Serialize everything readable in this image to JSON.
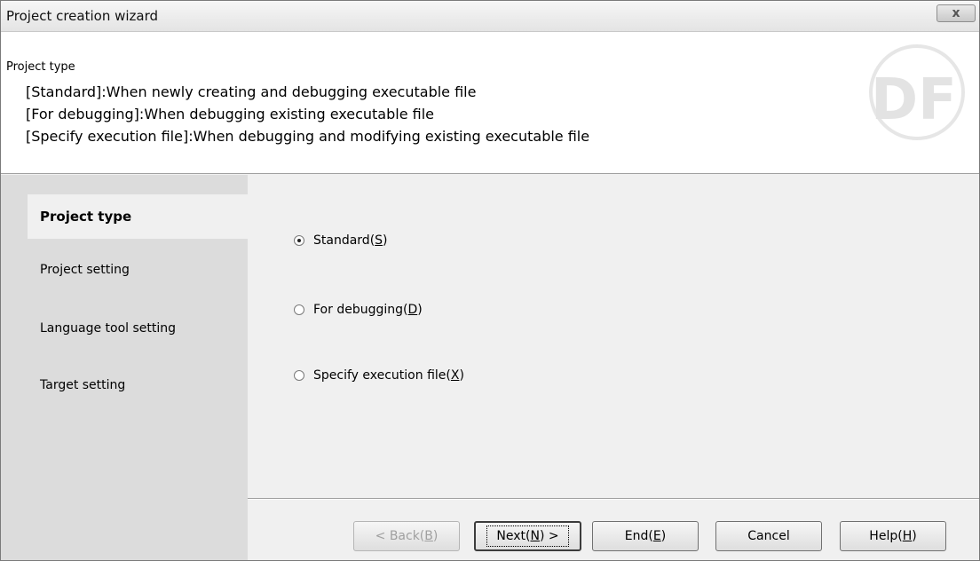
{
  "window": {
    "title": "Project creation wizard",
    "close_label": "x"
  },
  "header": {
    "title": "Project type",
    "lines": [
      "[Standard]:When newly creating and debugging executable file",
      "[For debugging]:When debugging existing executable file",
      "[Specify execution file]:When debugging and modifying existing executable file"
    ],
    "logo_text": "DF"
  },
  "sidebar": {
    "items": [
      {
        "label": "Project type",
        "active": true
      },
      {
        "label": "Project setting",
        "active": false
      },
      {
        "label": "Language tool setting",
        "active": false
      },
      {
        "label": "Target setting",
        "active": false
      }
    ]
  },
  "options": [
    {
      "label": "Standard(",
      "mnemonic": "S",
      "suffix": ")",
      "checked": true
    },
    {
      "label": "For debugging(",
      "mnemonic": "D",
      "suffix": ")",
      "checked": false
    },
    {
      "label": "Specify execution file(",
      "mnemonic": "X",
      "suffix": ")",
      "checked": false
    }
  ],
  "buttons": {
    "back": {
      "pre": "< Back(",
      "key": "B",
      "post": ")"
    },
    "next": {
      "pre": "Next(",
      "key": "N",
      "post": ") >"
    },
    "end": {
      "pre": "End(",
      "key": "E",
      "post": ")"
    },
    "cancel": {
      "label": "Cancel"
    },
    "help": {
      "pre": "Help(",
      "key": "H",
      "post": ")"
    }
  }
}
